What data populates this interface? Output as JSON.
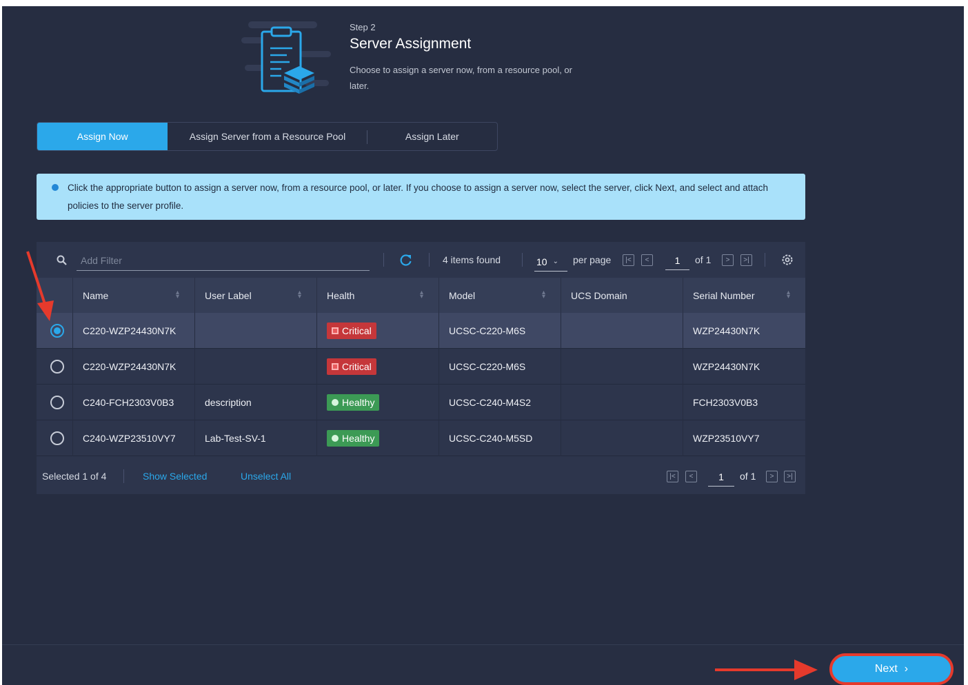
{
  "header": {
    "step_label": "Step 2",
    "title": "Server Assignment",
    "description": "Choose to assign a server now, from a resource pool, or later."
  },
  "tabs": [
    {
      "label": "Assign Now",
      "active": true
    },
    {
      "label": "Assign Server from a Resource Pool",
      "active": false
    },
    {
      "label": "Assign Later",
      "active": false
    }
  ],
  "info_banner": {
    "text": "Click the appropriate button to assign a server now, from a resource pool, or later. If you choose to assign a server now, select the server, click Next, and select and attach policies to the server profile."
  },
  "toolbar": {
    "filter_placeholder": "Add Filter",
    "items_found": "4 items found",
    "per_page_value": "10",
    "per_page_label": "per page",
    "page_current": "1",
    "page_of": "of 1"
  },
  "table": {
    "columns": [
      "Name",
      "User Label",
      "Health",
      "Model",
      "UCS Domain",
      "Serial Number"
    ],
    "rows": [
      {
        "name": "C220-WZP24430N7K",
        "user_label": "",
        "health": "Critical",
        "model": "UCSC-C220-M6S",
        "ucs_domain": "",
        "serial": "WZP24430N7K",
        "selected": true
      },
      {
        "name": "C220-WZP24430N7K",
        "user_label": "",
        "health": "Critical",
        "model": "UCSC-C220-M6S",
        "ucs_domain": "",
        "serial": "WZP24430N7K",
        "selected": false
      },
      {
        "name": "C240-FCH2303V0B3",
        "user_label": "description",
        "health": "Healthy",
        "model": "UCSC-C240-M4S2",
        "ucs_domain": "",
        "serial": "FCH2303V0B3",
        "selected": false
      },
      {
        "name": "C240-WZP23510VY7",
        "user_label": "Lab-Test-SV-1",
        "health": "Healthy",
        "model": "UCSC-C240-M5SD",
        "ucs_domain": "",
        "serial": "WZP23510VY7",
        "selected": false
      }
    ]
  },
  "footer": {
    "selected_text": "Selected 1 of 4",
    "show_selected": "Show Selected",
    "unselect_all": "Unselect All",
    "page_current": "1",
    "page_of": "of 1"
  },
  "next_button": {
    "label": "Next",
    "icon": "chevron-right-icon"
  },
  "colors": {
    "background": "#262d41",
    "accent": "#2ba8ea",
    "banner": "#a9e1fa",
    "critical": "#c5373a",
    "healthy": "#3c9a55",
    "annotation_arrow": "#e53a2c"
  }
}
